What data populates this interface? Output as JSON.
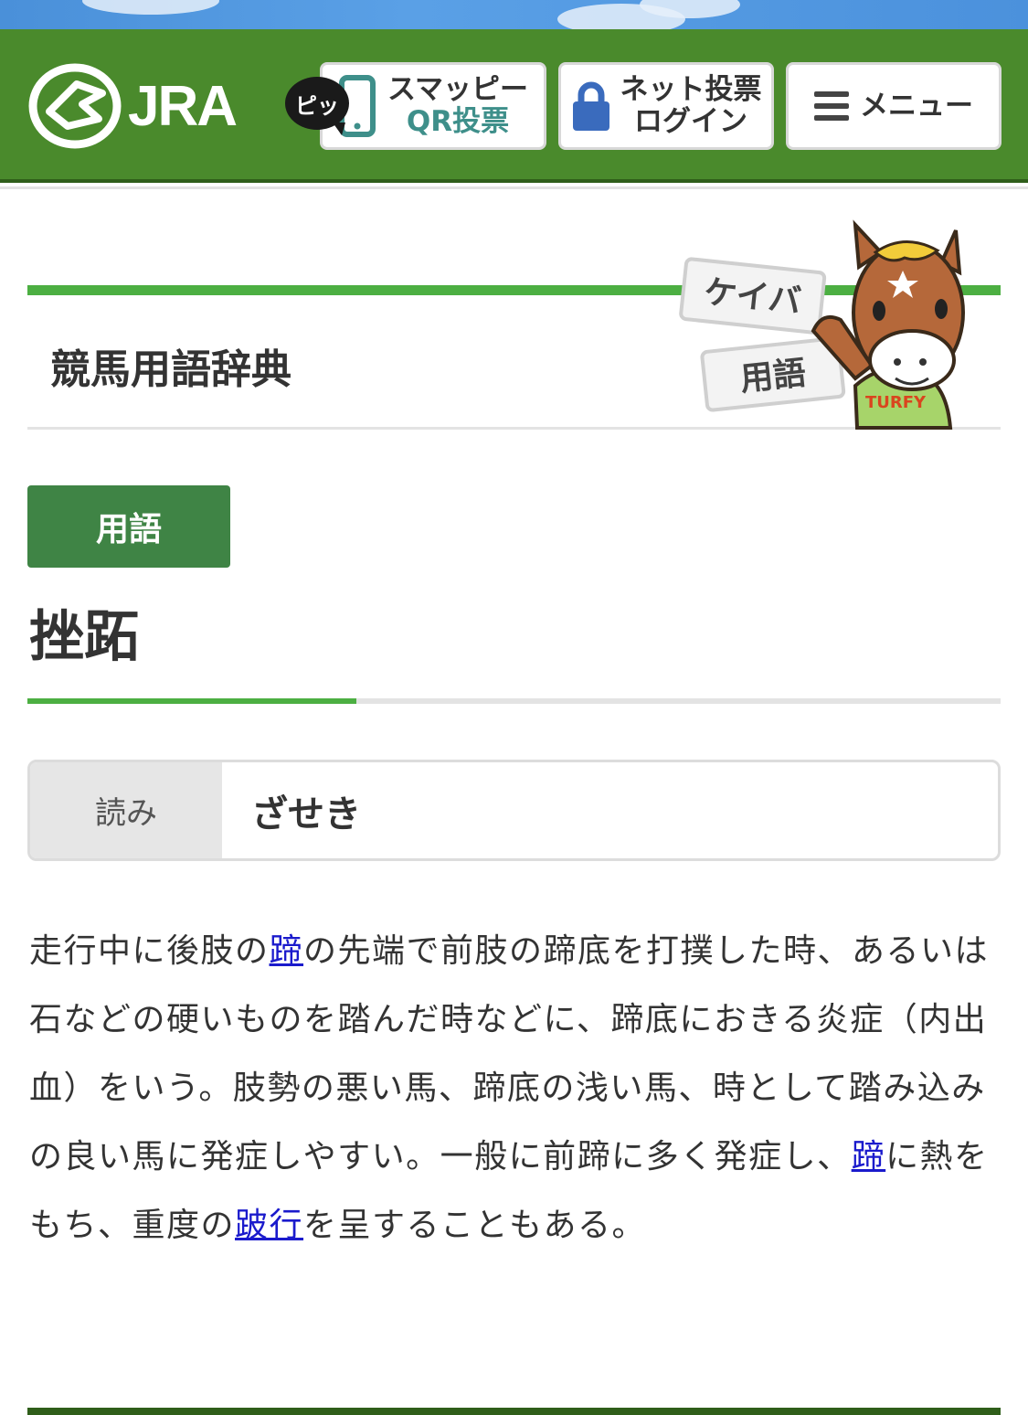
{
  "header": {
    "logo_text": "JRA",
    "pip_bubble": "ピッ",
    "smappy_line1": "スマッピー",
    "smappy_line2": "QR投票",
    "net_line1": "ネット投票",
    "net_line2": "ログイン",
    "menu_label": "メニュー"
  },
  "dictionary": {
    "title": "競馬用語辞典",
    "mascot_sign1": "ケイバ",
    "mascot_sign2": "用語",
    "mascot_shirt": "TURFY"
  },
  "term": {
    "badge": "用語",
    "name": "挫跖",
    "reading_label": "読み",
    "reading_value": "ざせき"
  },
  "description": {
    "p1": "走行中に後肢の",
    "link1": "蹄",
    "p2": "の先端で前肢の蹄底を打撲した時、あるいは石などの硬いものを踏んだ時などに、蹄底におきる炎症（内出血）をいう。肢勢の悪い馬、蹄底の浅い馬、時として踏み込みの良い馬に発症しやすい。一般に前蹄に多く発症し、",
    "link2": "蹄",
    "p3": "に熱をもち、重度の",
    "link3": "跛行",
    "p4": "を呈することもある。"
  },
  "colors": {
    "header_green": "#4a8a2c",
    "accent_green": "#4caf42",
    "badge_green": "#3f8445",
    "link_blue": "#1a1acc"
  }
}
